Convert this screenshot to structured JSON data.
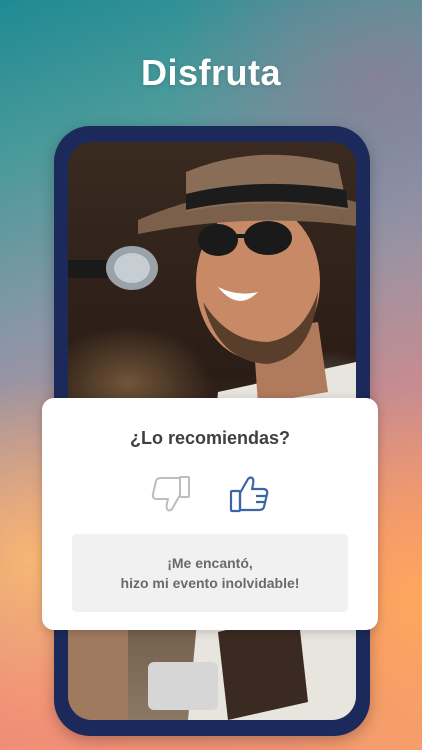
{
  "heading": "Disfruta",
  "card": {
    "question": "¿Lo recomiendas?",
    "review_line1": "¡Me encantó,",
    "review_line2": "hizo mi evento inolvidable!"
  },
  "icons": {
    "thumbs_down": "thumbs-down-icon",
    "thumbs_up": "thumbs-up-icon"
  },
  "colors": {
    "phone_frame": "#1b2a5a",
    "thumbs_up": "#3a66a8",
    "thumbs_down": "#bdbdbd"
  }
}
